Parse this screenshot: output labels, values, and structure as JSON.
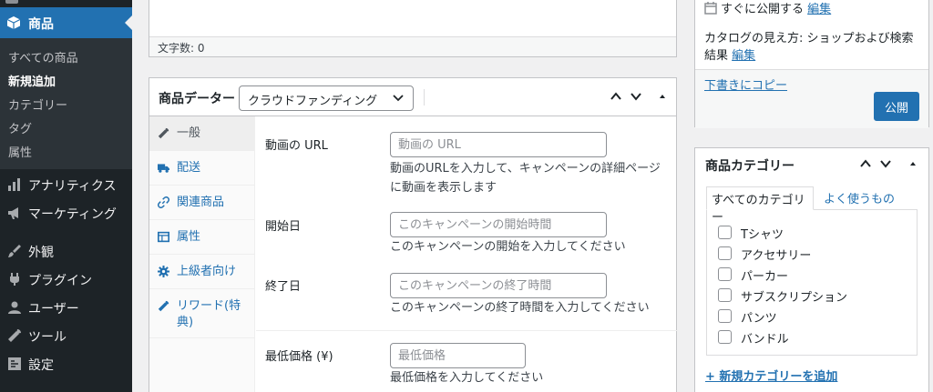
{
  "sidebar": {
    "active": {
      "label": "商品"
    },
    "submenu": [
      {
        "label": "すべての商品"
      },
      {
        "label": "新規追加"
      },
      {
        "label": "カテゴリー"
      },
      {
        "label": "タグ"
      },
      {
        "label": "属性"
      }
    ],
    "items": [
      {
        "label": "アナリティクス",
        "icon": "bar-chart-icon"
      },
      {
        "label": "マーケティング",
        "icon": "megaphone-icon"
      },
      {
        "label": "外観",
        "icon": "paintbrush-icon"
      },
      {
        "label": "プラグイン",
        "icon": "plugin-icon"
      },
      {
        "label": "ユーザー",
        "icon": "user-icon"
      },
      {
        "label": "ツール",
        "icon": "wrench-icon"
      },
      {
        "label": "設定",
        "icon": "settings-icon"
      }
    ]
  },
  "editor": {
    "word_count": "文字数: 0"
  },
  "product_data": {
    "title": "商品データー",
    "type_selected": "クラウドファンディング",
    "tabs": [
      {
        "label": "一般",
        "icon": "wrench-icon"
      },
      {
        "label": "配送",
        "icon": "truck-icon"
      },
      {
        "label": "関連商品",
        "icon": "link-icon"
      },
      {
        "label": "属性",
        "icon": "table-icon"
      },
      {
        "label": "上級者向け",
        "icon": "gear-icon"
      },
      {
        "label": "リワード(特典)",
        "icon": "wrench-icon"
      }
    ],
    "fields": [
      {
        "label": "動画の URL",
        "placeholder": "動画の URL",
        "desc": "動画のURLを入力して、キャンペーンの詳細ページに動画を表示します"
      },
      {
        "label": "開始日",
        "placeholder": "このキャンペーンの開始時間",
        "desc": "このキャンペーンの開始を入力してください"
      },
      {
        "label": "終了日",
        "placeholder": "このキャンペーンの終了時間",
        "desc": "このキャンペーンの終了時間を入力してください"
      },
      {
        "label": "最低価格 (¥)",
        "placeholder": "最低価格",
        "desc": "最低価格を入力してください"
      }
    ]
  },
  "publish": {
    "schedule_text": "すぐに公開する",
    "edit_label": "編集",
    "catalog_text": "カタログの見え方: ショップおよび検索結果",
    "catalog_edit": "編集",
    "copy_draft": "下書きにコピー",
    "publish_button": "公開"
  },
  "categories": {
    "title": "商品カテゴリー",
    "tab_all": "すべてのカテゴリー",
    "tab_popular": "よく使うもの",
    "items": [
      "Tシャツ",
      "アクセサリー",
      "パーカー",
      "サブスクリプション",
      "パンツ",
      "バンドル"
    ],
    "add_new": "+ 新規カテゴリーを追加"
  }
}
